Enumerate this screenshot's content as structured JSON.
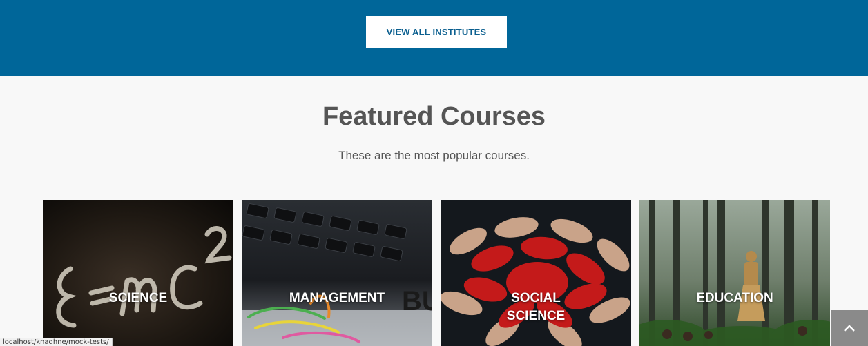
{
  "header_band": {
    "button_label": "VIEW ALL INSTITUTES",
    "color": "#006699"
  },
  "featured": {
    "title": "Featured Courses",
    "subtitle": "These are the most popular courses.",
    "courses": [
      {
        "label_lines": [
          "SCIENCE"
        ],
        "image": "equation-chalkboard"
      },
      {
        "label_lines": [
          "MANAGEMENT"
        ],
        "image": "calculator-paperclips"
      },
      {
        "label_lines": [
          "SOCIAL",
          "SCIENCE"
        ],
        "image": "painted-hands"
      },
      {
        "label_lines": [
          "EDUCATION"
        ],
        "image": "forest-children"
      }
    ]
  },
  "status_bar": {
    "url": "localhost/knadhne/mock-tests/"
  },
  "scroll_top": {
    "icon": "chevron-up-icon"
  }
}
